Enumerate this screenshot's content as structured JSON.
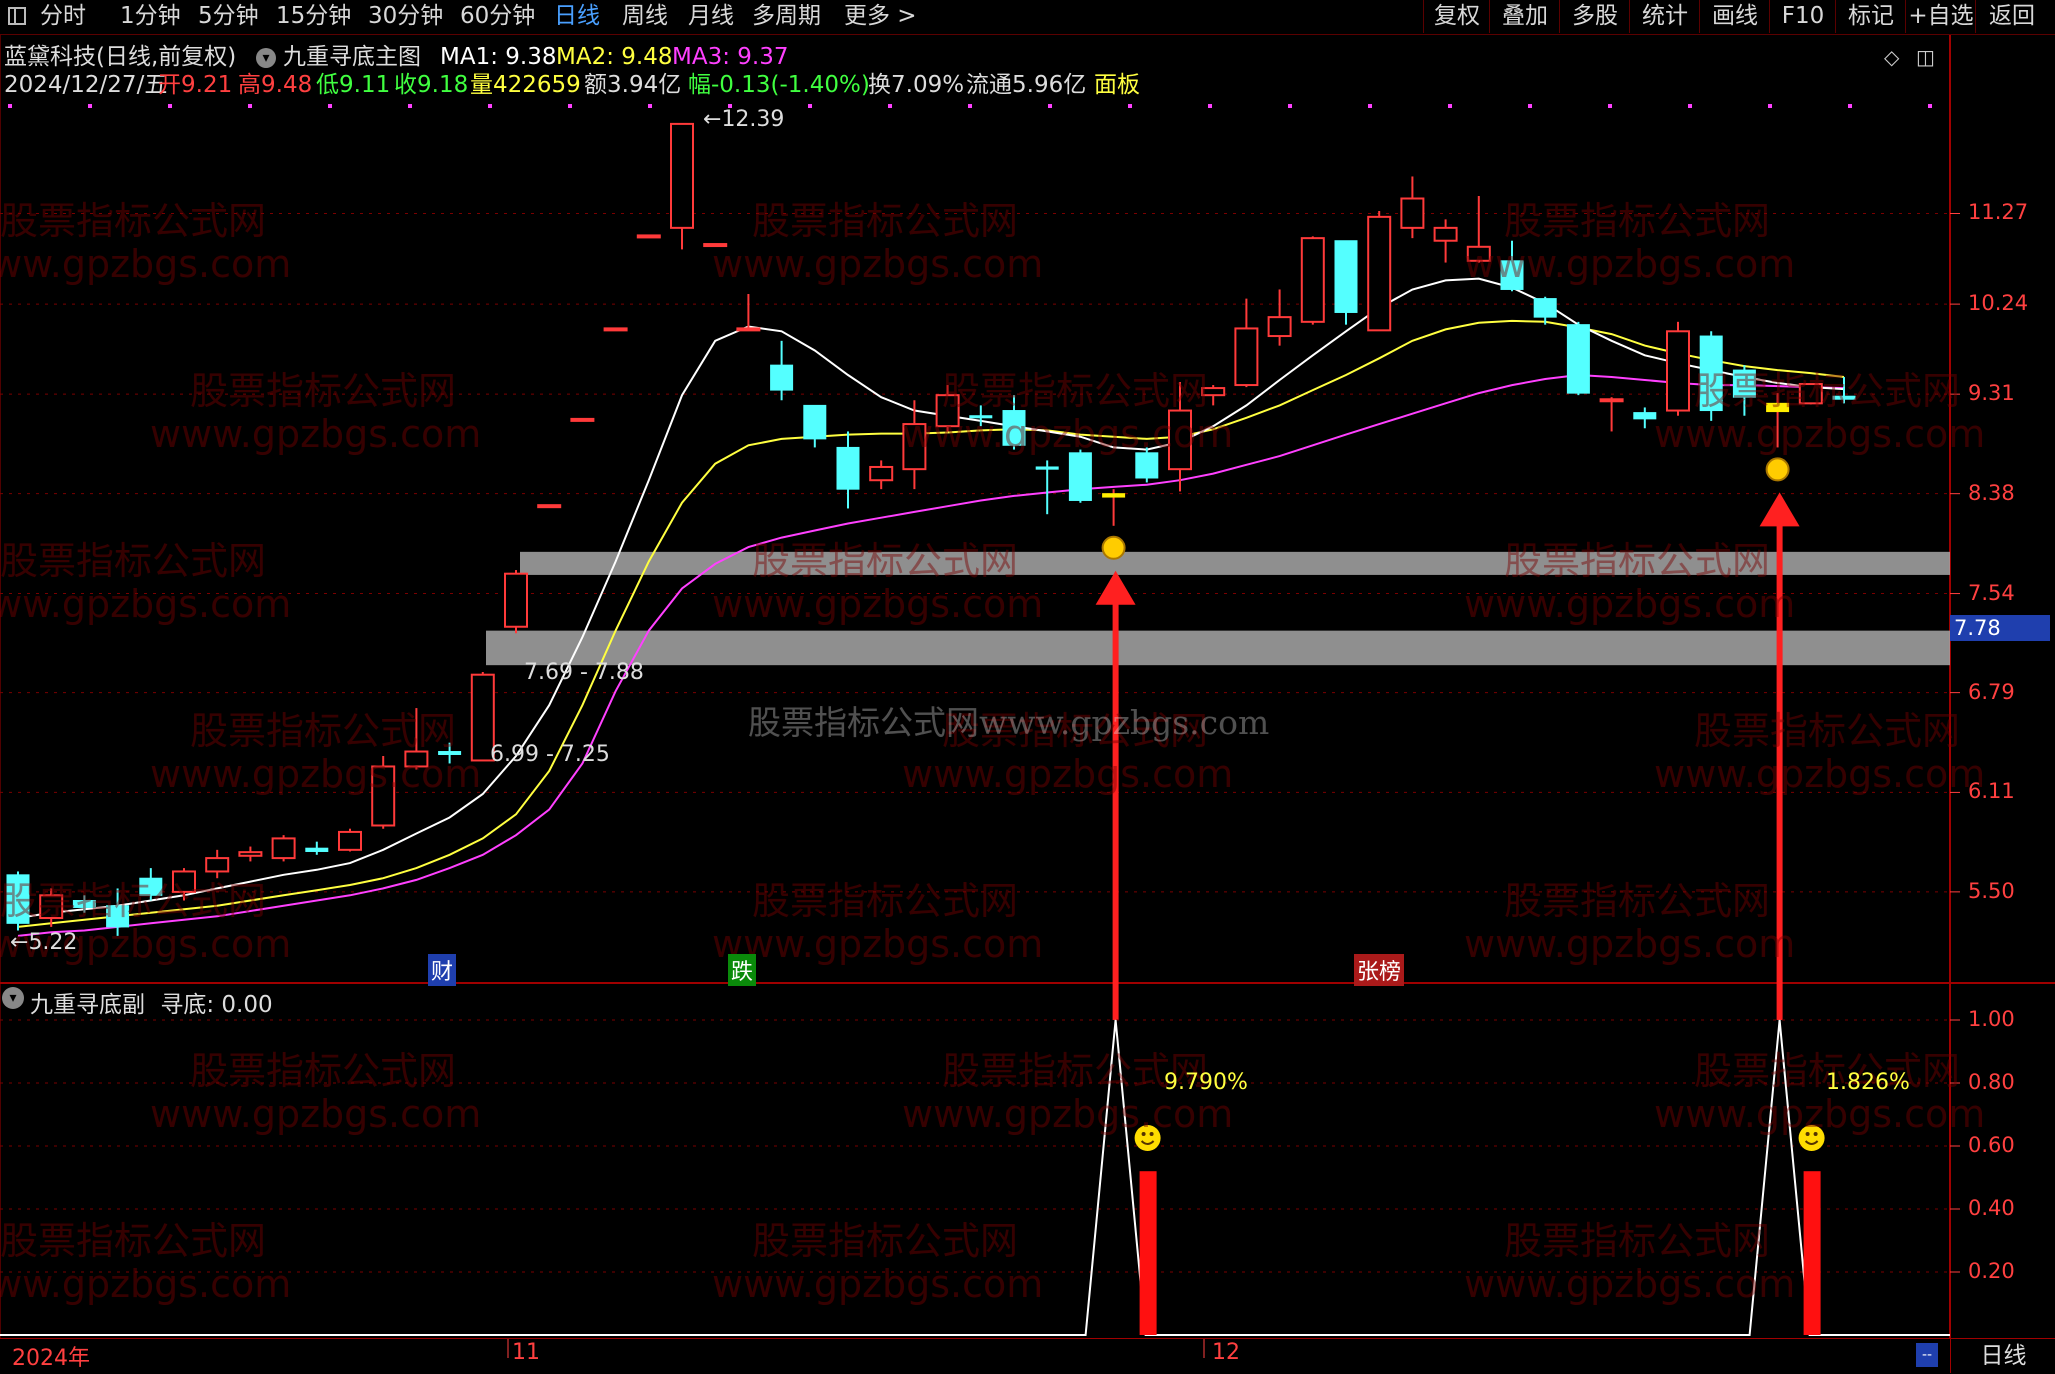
{
  "toolbar": {
    "left_items": [
      "分时",
      "1分钟",
      "5分钟",
      "15分钟",
      "30分钟",
      "60分钟",
      "日线",
      "周线",
      "月线",
      "多周期",
      "更多 >"
    ],
    "active_item": "日线",
    "right_items": [
      "复权",
      "叠加",
      "多股",
      "统计",
      "画线",
      "F10",
      "标记",
      "+自选",
      "返回"
    ]
  },
  "header": {
    "stock_name": "蓝黛科技(日线,前复权)",
    "indicator_name": "九重寻底主图",
    "ma1": "MA1: 9.38",
    "ma2": "MA2: 9.48",
    "ma3": "MA3: 9.37",
    "date": "2024/12/27/五",
    "open": "开9.21",
    "high": "高9.48",
    "low": "低9.11",
    "close": "收9.18",
    "volume": "量422659",
    "amount": "额3.94亿",
    "change": "幅-0.13(-1.40%)",
    "turnover": "换7.09%",
    "float": "流通5.96亿",
    "panel": "面板"
  },
  "colors": {
    "up": "#ff3a3a",
    "down": "#54ffff",
    "ma1": "#ffffff",
    "ma2": "#ffff40",
    "ma3": "#ff40ff",
    "axis": "#ff4040",
    "grid": "#7a0000",
    "zone": "#a8a8a8",
    "arrow": "#ff2020"
  },
  "price_axis": {
    "ticks": [
      "11.27",
      "10.24",
      "9.31",
      "8.38",
      "7.54",
      "6.79",
      "6.11",
      "5.50"
    ],
    "current": "7.78"
  },
  "annotations": {
    "high_label": "12.39",
    "low_label": "5.22",
    "zone_upper": "7.69 - 7.88",
    "zone_lower": "6.99 - 7.25",
    "event_cai": "财",
    "event_die": "跌",
    "event_zhangbang": "张榜"
  },
  "sub_panel": {
    "title": "九重寻底副",
    "value_label": "寻底: 0.00",
    "ticks": [
      "1.00",
      "0.80",
      "0.60",
      "0.40",
      "0.20"
    ],
    "signal1_pct": "9.790%",
    "signal2_pct": "1.826%"
  },
  "time_axis": {
    "labels": [
      "2024年",
      "11",
      "12"
    ],
    "period": "日线"
  },
  "watermark": {
    "text_cn": "股票指标公式网",
    "text_url": "www.gpzbgs.com",
    "text_center": "股票指标公式网www.gpzbgs.com"
  },
  "chart_data": {
    "type": "candlestick",
    "ylim": [
      5.0,
      12.6
    ],
    "candles": [
      {
        "o": 5.6,
        "h": 5.62,
        "l": 5.28,
        "c": 5.32
      },
      {
        "o": 5.35,
        "h": 5.52,
        "l": 5.3,
        "c": 5.48
      },
      {
        "o": 5.45,
        "h": 5.48,
        "l": 5.38,
        "c": 5.41
      },
      {
        "o": 5.42,
        "h": 5.52,
        "l": 5.25,
        "c": 5.3
      },
      {
        "o": 5.58,
        "h": 5.64,
        "l": 5.45,
        "c": 5.48
      },
      {
        "o": 5.5,
        "h": 5.64,
        "l": 5.45,
        "c": 5.62
      },
      {
        "o": 5.62,
        "h": 5.75,
        "l": 5.58,
        "c": 5.7
      },
      {
        "o": 5.72,
        "h": 5.77,
        "l": 5.68,
        "c": 5.73
      },
      {
        "o": 5.7,
        "h": 5.84,
        "l": 5.68,
        "c": 5.82
      },
      {
        "o": 5.76,
        "h": 5.8,
        "l": 5.72,
        "c": 5.74
      },
      {
        "o": 5.75,
        "h": 5.88,
        "l": 5.74,
        "c": 5.86
      },
      {
        "o": 5.9,
        "h": 6.35,
        "l": 5.88,
        "c": 6.28
      },
      {
        "o": 6.28,
        "h": 6.68,
        "l": 6.26,
        "c": 6.38
      },
      {
        "o": 6.38,
        "h": 6.44,
        "l": 6.3,
        "c": 6.36
      },
      {
        "o": 6.32,
        "h": 6.94,
        "l": 6.32,
        "c": 6.92
      },
      {
        "o": 7.28,
        "h": 7.73,
        "l": 7.23,
        "c": 7.7
      },
      {
        "o": 8.27,
        "h": 8.27,
        "l": 8.27,
        "c": 8.27
      },
      {
        "o": 9.06,
        "h": 9.06,
        "l": 9.06,
        "c": 9.06
      },
      {
        "o": 9.97,
        "h": 9.97,
        "l": 9.97,
        "c": 9.97
      },
      {
        "o": 11.0,
        "h": 11.0,
        "l": 11.0,
        "c": 11.0
      },
      {
        "o": 11.1,
        "h": 12.39,
        "l": 10.85,
        "c": 12.39
      },
      {
        "o": 10.9,
        "h": 10.9,
        "l": 10.9,
        "c": 10.9
      },
      {
        "o": 9.97,
        "h": 10.35,
        "l": 9.97,
        "c": 9.97
      },
      {
        "o": 9.6,
        "h": 9.85,
        "l": 9.25,
        "c": 9.35
      },
      {
        "o": 9.2,
        "h": 9.2,
        "l": 8.8,
        "c": 8.88
      },
      {
        "o": 8.8,
        "h": 8.95,
        "l": 8.25,
        "c": 8.42
      },
      {
        "o": 8.5,
        "h": 8.68,
        "l": 8.42,
        "c": 8.62
      },
      {
        "o": 8.6,
        "h": 9.25,
        "l": 8.42,
        "c": 9.02
      },
      {
        "o": 9.0,
        "h": 9.4,
        "l": 8.95,
        "c": 9.3
      },
      {
        "o": 9.1,
        "h": 9.2,
        "l": 9.0,
        "c": 9.08
      },
      {
        "o": 9.15,
        "h": 9.3,
        "l": 8.78,
        "c": 8.82
      },
      {
        "o": 8.62,
        "h": 8.68,
        "l": 8.2,
        "c": 8.6
      },
      {
        "o": 8.75,
        "h": 8.78,
        "l": 8.3,
        "c": 8.32
      },
      {
        "o": 8.35,
        "h": 8.42,
        "l": 8.1,
        "c": 8.38
      },
      {
        "o": 8.75,
        "h": 8.8,
        "l": 8.48,
        "c": 8.52
      },
      {
        "o": 8.6,
        "h": 9.43,
        "l": 8.4,
        "c": 9.15
      },
      {
        "o": 9.3,
        "h": 9.4,
        "l": 9.2,
        "c": 9.37
      },
      {
        "o": 9.4,
        "h": 10.3,
        "l": 9.38,
        "c": 9.98
      },
      {
        "o": 9.9,
        "h": 10.4,
        "l": 9.8,
        "c": 10.1
      },
      {
        "o": 10.05,
        "h": 11.0,
        "l": 10.02,
        "c": 10.98
      },
      {
        "o": 10.95,
        "h": 10.95,
        "l": 10.02,
        "c": 10.15
      },
      {
        "o": 9.96,
        "h": 11.3,
        "l": 9.96,
        "c": 11.23
      },
      {
        "o": 11.1,
        "h": 11.72,
        "l": 10.98,
        "c": 11.45
      },
      {
        "o": 10.95,
        "h": 11.2,
        "l": 10.7,
        "c": 11.1
      },
      {
        "o": 10.72,
        "h": 11.48,
        "l": 10.7,
        "c": 10.88
      },
      {
        "o": 10.72,
        "h": 10.95,
        "l": 10.38,
        "c": 10.4
      },
      {
        "o": 10.3,
        "h": 10.32,
        "l": 10.02,
        "c": 10.1
      },
      {
        "o": 10.02,
        "h": 10.05,
        "l": 9.3,
        "c": 9.32
      },
      {
        "o": 9.25,
        "h": 9.28,
        "l": 8.95,
        "c": 9.25
      },
      {
        "o": 9.13,
        "h": 9.18,
        "l": 8.98,
        "c": 9.07
      },
      {
        "o": 9.15,
        "h": 10.05,
        "l": 9.1,
        "c": 9.95
      },
      {
        "o": 9.9,
        "h": 9.95,
        "l": 9.05,
        "c": 9.15
      },
      {
        "o": 9.55,
        "h": 9.6,
        "l": 9.1,
        "c": 9.28
      },
      {
        "o": 9.14,
        "h": 9.32,
        "l": 8.8,
        "c": 9.22
      },
      {
        "o": 9.22,
        "h": 9.41,
        "l": 9.21,
        "c": 9.41
      },
      {
        "o": 9.28,
        "h": 9.48,
        "l": 9.22,
        "c": 9.27
      }
    ],
    "signal_candles": [
      33,
      53
    ],
    "ma1": [
      5.35,
      5.38,
      5.4,
      5.42,
      5.45,
      5.48,
      5.52,
      5.56,
      5.6,
      5.63,
      5.67,
      5.75,
      5.85,
      5.95,
      6.1,
      6.35,
      6.7,
      7.2,
      7.8,
      8.5,
      9.3,
      9.85,
      10.0,
      9.95,
      9.75,
      9.5,
      9.28,
      9.15,
      9.1,
      9.05,
      9.0,
      8.95,
      8.9,
      8.8,
      8.78,
      8.85,
      9.0,
      9.2,
      9.45,
      9.7,
      9.95,
      10.2,
      10.4,
      10.5,
      10.52,
      10.42,
      10.25,
      10.02,
      9.85,
      9.7,
      9.62,
      9.55,
      9.48,
      9.42,
      9.38,
      9.36
    ],
    "ma2": [
      5.3,
      5.32,
      5.34,
      5.36,
      5.38,
      5.4,
      5.42,
      5.45,
      5.48,
      5.51,
      5.54,
      5.58,
      5.64,
      5.72,
      5.82,
      5.97,
      6.25,
      6.7,
      7.25,
      7.8,
      8.3,
      8.65,
      8.82,
      8.88,
      8.9,
      8.92,
      8.93,
      8.93,
      8.94,
      8.96,
      8.97,
      8.96,
      8.92,
      8.9,
      8.88,
      8.9,
      8.97,
      9.08,
      9.2,
      9.35,
      9.5,
      9.67,
      9.85,
      9.97,
      10.04,
      10.06,
      10.05,
      9.99,
      9.92,
      9.8,
      9.72,
      9.65,
      9.59,
      9.55,
      9.52,
      9.48
    ],
    "ma3": [
      5.25,
      5.27,
      5.28,
      5.3,
      5.32,
      5.34,
      5.36,
      5.39,
      5.42,
      5.45,
      5.48,
      5.52,
      5.57,
      5.64,
      5.72,
      5.84,
      6.0,
      6.3,
      6.8,
      7.25,
      7.58,
      7.78,
      7.92,
      8.0,
      8.06,
      8.12,
      8.17,
      8.22,
      8.27,
      8.32,
      8.36,
      8.39,
      8.42,
      8.44,
      8.46,
      8.5,
      8.56,
      8.64,
      8.72,
      8.82,
      8.92,
      9.02,
      9.12,
      9.22,
      9.32,
      9.4,
      9.46,
      9.5,
      9.48,
      9.45,
      9.42,
      9.4,
      9.4,
      9.39,
      9.38,
      9.37
    ],
    "zones": [
      [
        7.69,
        7.88
      ],
      [
        6.99,
        7.25
      ]
    ],
    "sub_signal_candles": [
      33,
      53
    ],
    "sub_signal_values": [
      1.0,
      1.0
    ],
    "sub_bar_values": [
      0.52,
      0.52
    ]
  }
}
